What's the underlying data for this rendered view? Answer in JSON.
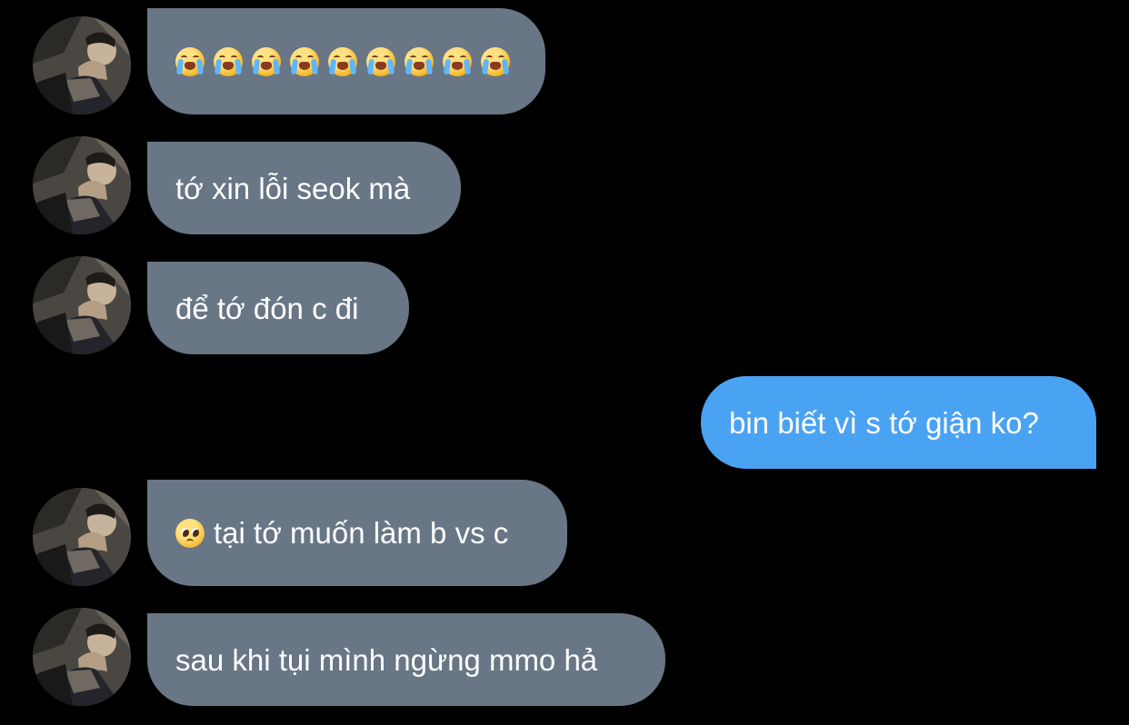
{
  "messages": [
    {
      "side": "incoming",
      "emoji": "loudly-crying-face",
      "emoji_count": 9
    },
    {
      "side": "incoming",
      "text": "tớ xin lỗi seok mà"
    },
    {
      "side": "incoming",
      "text": "để tớ đón c đi"
    },
    {
      "side": "outgoing",
      "text": "bin biết vì s tớ giận ko?"
    },
    {
      "side": "incoming",
      "leading_emoji": "pleading-face",
      "text": "tại tớ muốn làm b vs c"
    },
    {
      "side": "incoming",
      "text": "sau khi tụi mình ngừng mmo hả"
    }
  ],
  "colors": {
    "background": "#000000",
    "incoming_bubble": "#687685",
    "outgoing_bubble": "#4aa2f2",
    "text": "#ffffff"
  }
}
